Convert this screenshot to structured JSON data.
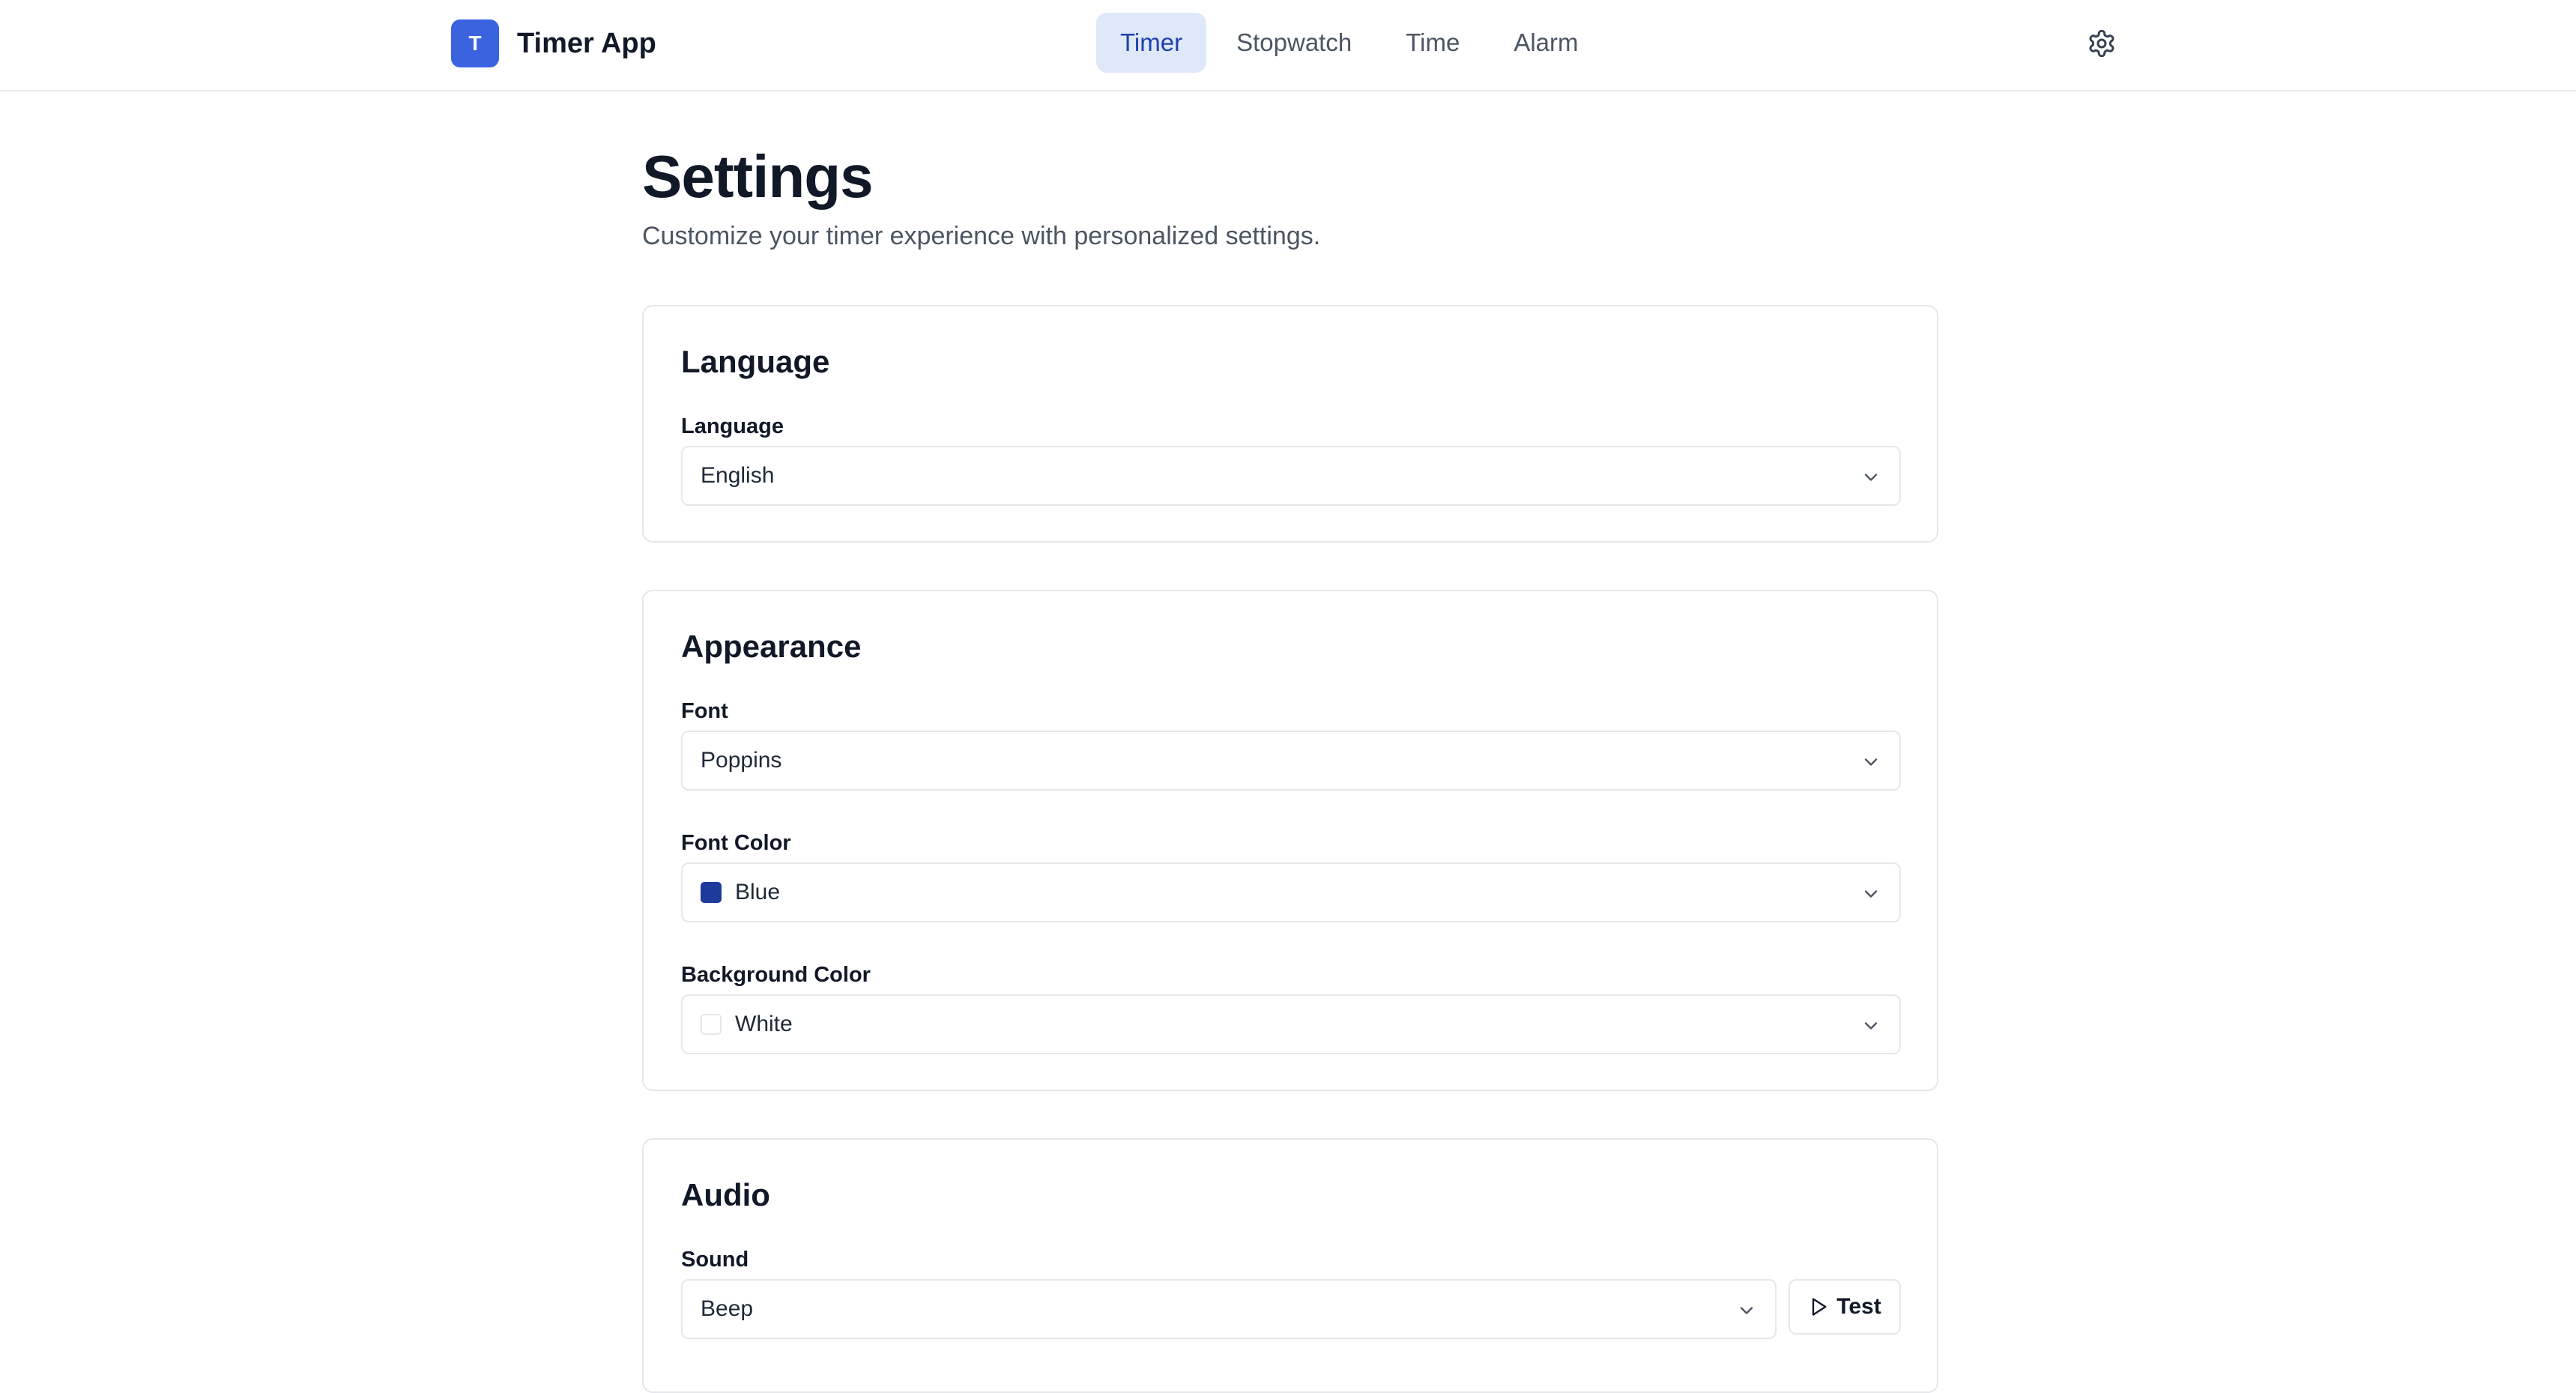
{
  "brand": {
    "logo_letter": "T",
    "name": "Timer App"
  },
  "nav": {
    "tabs": [
      {
        "label": "Timer",
        "active": true
      },
      {
        "label": "Stopwatch",
        "active": false
      },
      {
        "label": "Time",
        "active": false
      },
      {
        "label": "Alarm",
        "active": false
      }
    ],
    "settings_icon": "gear-icon"
  },
  "page": {
    "title": "Settings",
    "subtitle": "Customize your timer experience with personalized settings."
  },
  "sections": {
    "language": {
      "title": "Language",
      "language_label": "Language",
      "language_value": "English"
    },
    "appearance": {
      "title": "Appearance",
      "font_label": "Font",
      "font_value": "Poppins",
      "font_color_label": "Font Color",
      "font_color_value": "Blue",
      "font_color_swatch": "#1e3a9a",
      "background_color_label": "Background Color",
      "background_color_value": "White",
      "background_color_swatch": "#ffffff"
    },
    "audio": {
      "title": "Audio",
      "sound_label": "Sound",
      "sound_value": "Beep",
      "test_label": "Test"
    }
  },
  "colors": {
    "accent": "#3b63e0",
    "active_tab_bg": "#dfe8f8",
    "active_tab_text": "#1e40af",
    "border": "#e5e7eb"
  }
}
